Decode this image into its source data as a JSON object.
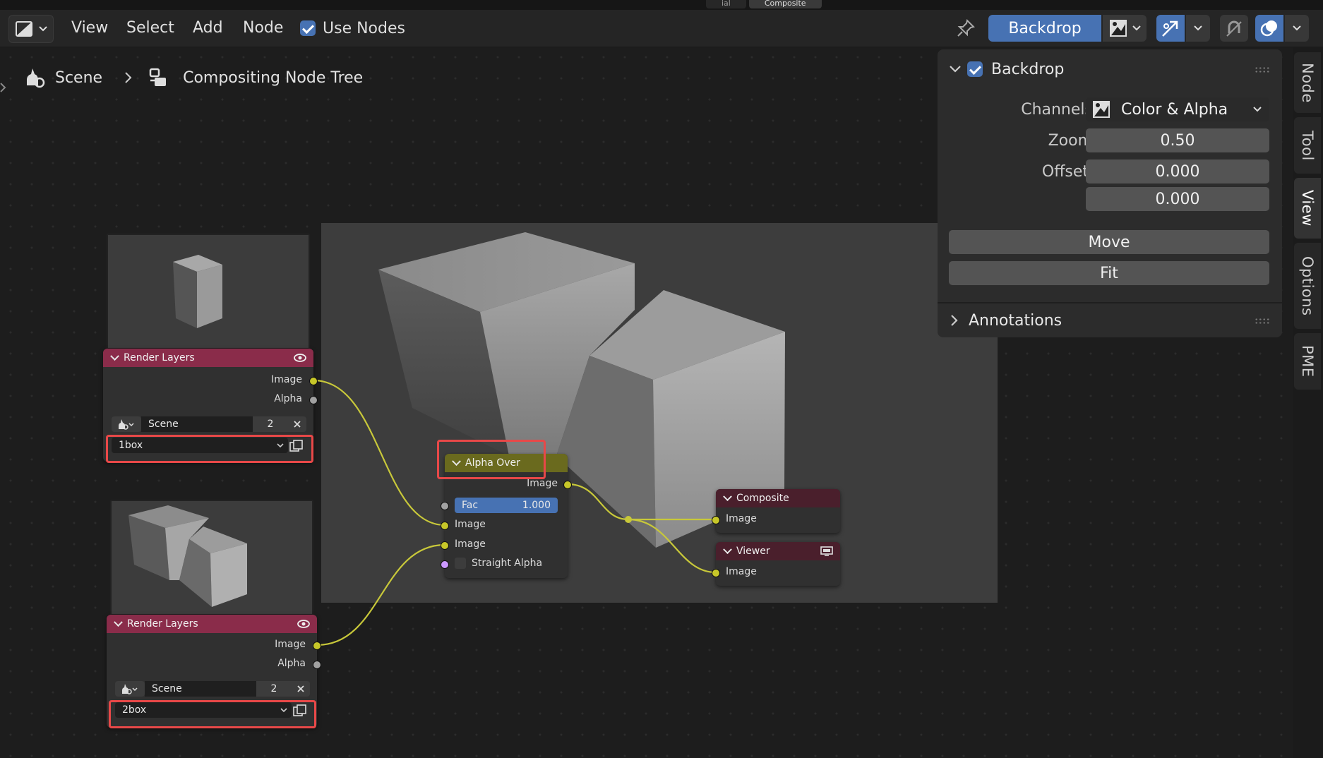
{
  "header": {
    "menu": [
      "View",
      "Select",
      "Add",
      "Node"
    ],
    "use_nodes_label": "Use Nodes",
    "backdrop_button": "Backdrop"
  },
  "breadcrumb": {
    "scene": "Scene",
    "tree": "Compositing Node Tree"
  },
  "nodes": {
    "render_layers_1": {
      "title": "Render Layers",
      "outputs": [
        "Image",
        "Alpha"
      ],
      "scene": "Scene",
      "users": "2",
      "layer": "1box"
    },
    "render_layers_2": {
      "title": "Render Layers",
      "outputs": [
        "Image",
        "Alpha"
      ],
      "scene": "Scene",
      "users": "2",
      "layer": "2box"
    },
    "alpha_over": {
      "title": "Alpha Over",
      "output": "Image",
      "fac_label": "Fac",
      "fac_value": "1.000",
      "inputs": [
        "Image",
        "Image"
      ],
      "straight_alpha": "Straight Alpha"
    },
    "composite": {
      "title": "Composite",
      "input": "Image"
    },
    "viewer": {
      "title": "Viewer",
      "input": "Image"
    }
  },
  "panel": {
    "backdrop_title": "Backdrop",
    "channels_label": "Channels",
    "channels_value": "Color & Alpha",
    "zoom_label": "Zoom",
    "zoom_value": "0.50",
    "offset_label": "Offset",
    "offset_x": "0.000",
    "offset_y": "0.000",
    "move_button": "Move",
    "fit_button": "Fit",
    "annotations_title": "Annotations"
  },
  "side_tabs": [
    "Node",
    "Tool",
    "View",
    "Options",
    "PME"
  ],
  "top_tabs": [
    "ial",
    "Composite"
  ],
  "colors": {
    "render_layers_header": "#8a2c4a",
    "alpha_over_header": "#6a6a1e",
    "output_header": "#4a1f2c",
    "accent": "#4772b3",
    "highlight": "#e84848"
  }
}
